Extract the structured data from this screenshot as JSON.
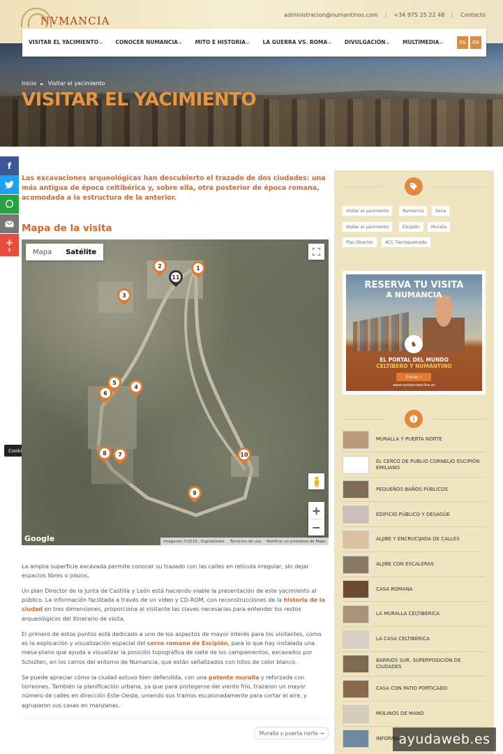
{
  "header": {
    "logo_text": "NVMANCIA",
    "email": "administracion@numantinos.com",
    "phone": "+34 975 25 22 48",
    "contact": "Contacto",
    "nav": [
      {
        "label": "VISITAR EL YACIMIENTO"
      },
      {
        "label": "CONOCER NUMANCIA"
      },
      {
        "label": "MITO E HISTORIA"
      },
      {
        "label": "LA GUERRA VS. ROMA"
      },
      {
        "label": "DIVULGACIÓN"
      },
      {
        "label": "MULTIMEDIA"
      }
    ],
    "lang_es": "ES",
    "lang_en": "EN"
  },
  "hero": {
    "breadcrumb_home": "Inicio",
    "breadcrumb_sep": "►",
    "breadcrumb_current": "Visitar el yacimiento",
    "title": "VISITAR EL YACIMIENTO"
  },
  "social": {
    "share_count": "2",
    "cookie_settings": "Cookie settings"
  },
  "main": {
    "intro": "Las excavaciones arqueológicas han descubierto el trazado de dos ciudades: una más antigua de época celtibérica y, sobre ella, otra posterior de época romana, acomodada a la estructura de la anterior.",
    "map_heading": "Mapa de la visita",
    "map": {
      "tab_map": "Mapa",
      "tab_satellite": "Satélite",
      "google": "Google",
      "footer_images": "Imágenes ©2019 , DigitalGlobe",
      "footer_terms": "Términos de uso",
      "footer_report": "Notificar un problema de Maps",
      "markers": [
        "1",
        "2",
        "3",
        "4",
        "5",
        "6",
        "7",
        "8",
        "9",
        "10",
        "11"
      ]
    },
    "p1": "La amplia superficie excavada permite conocer su trazado con las calles en retícula irregular, sin dejar espacios libres o plazos.",
    "p2a": "Un plan Director de la Junta de Castilla y León está haciendo viable la presentación de este yacimiento al público. La información facilitada a través de un vídeo y CD-ROM, con reconstrucciones de la ",
    "p2_link": "historia de la ciudad",
    "p2b": " en tres dimensiones, proporciona al visitante las claves necesarias para entender los restos arqueológicos del itinerario de visita.",
    "p3a": "El primero de estos puntos está dedicado a uno de los aspectos de mayor interés para los visitantes, como es la explicación y visualización espacial del ",
    "p3_link": "cerco romano de Escipión",
    "p3b": ", para lo que hay instalada una mesa-plano que ayuda a visualizar la posición topográfica de siete de los campamentos, excavados por Schulten, en los cerros del entorno de Numancia, que están señalizados con hitos de color blanco.",
    "p4a": "Se puede apreciar cómo la ciudad estuvo bien defendida, con una ",
    "p4_link": "potente muralla",
    "p4b": " y reforzada con torreones. También la planificación urbana, ya que para protegerse del viento frío, trazaron un mayor número de calles en dirección Este-Oeste, uniendo sus tramos escalonadamente para cortar el aire, y agruparon sus casas en manzanas.",
    "next_button": "Muralla y puerta norte →"
  },
  "sidebar": {
    "tags": [
      "Visitar el yacimiento",
      "Numancia",
      "Soria",
      "Visitar el yacimiento",
      "Escipión",
      "Muralla",
      "Plan Director",
      "ACC Tierraquemada"
    ],
    "promo": {
      "title_line1": "RESERVA TU VISITA",
      "title_line2": "A NUMANCIA",
      "sub_line1": "EL PORTAL DEL MUNDO",
      "sub_line2": "CELTIBERO Y NUMANTINO",
      "button": "Entrar ›",
      "url": "www.numanciaonline.es"
    },
    "items": [
      {
        "label": "MURALLA Y PUERTA NORTE",
        "color": "#b99a7a"
      },
      {
        "label": "EL CERCO DE PUBLIO CORNELIO ESCIPIÓN EMILIANO",
        "color": "#ffffff"
      },
      {
        "label": "PEQUEÑOS BAÑOS PÚBLICOS",
        "color": "#7f6c55"
      },
      {
        "label": "EDIFICIO PÚBLICO Y DESAGÜE",
        "color": "#c8c0b8"
      },
      {
        "label": "ALJIBE Y ENCRUCIJADA DE CALLES",
        "color": "#d8c0a0"
      },
      {
        "label": "ALJIBE CON ESCALERAS",
        "color": "#8a7a66"
      },
      {
        "label": "CASA ROMANA",
        "color": "#6b4a33"
      },
      {
        "label": "LA MURALLA CELTIBÉRICA",
        "color": "#a89478"
      },
      {
        "label": "LA CASA CELTIBÉRICA",
        "color": "#d8d0c6"
      },
      {
        "label": "BARRIOS SUR, SUPERPOSICIÓN DE CIUDADES",
        "color": "#7d6a50"
      },
      {
        "label": "CASA CON PATIO PORTICADO",
        "color": "#8a6a4a"
      },
      {
        "label": "MOLINOS DE MANO",
        "color": "#d6ccbc"
      },
      {
        "label": "INFORMA...",
        "color": "#6e8aa0"
      }
    ]
  },
  "watermark": "ayudaweb.es"
}
